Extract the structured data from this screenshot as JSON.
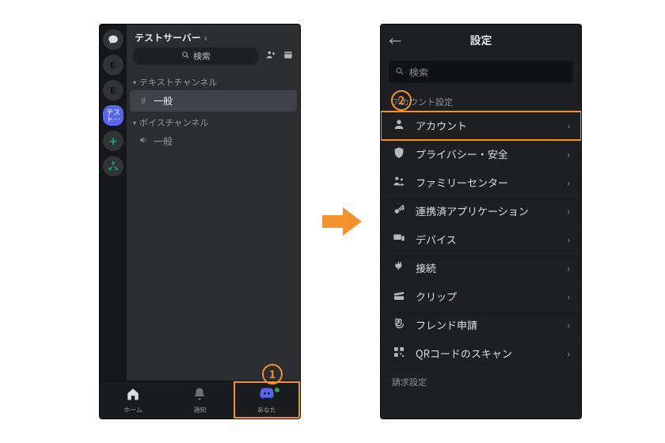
{
  "left": {
    "serverRail": {
      "activeLabel": "テスト…"
    },
    "serverName": "テストサーバー",
    "searchLabel": "検索",
    "categories": {
      "text": "テキストチャンネル",
      "voice": "ボイスチャンネル"
    },
    "channels": {
      "textGeneral": "一般",
      "voiceGeneral": "一般"
    },
    "tabs": {
      "home": "ホーム",
      "notify": "通知",
      "you": "あなた"
    }
  },
  "right": {
    "title": "設定",
    "searchPlaceholder": "検索",
    "groups": {
      "account": "アカウント設定",
      "billing": "請求設定"
    },
    "rows": {
      "account": "アカウント",
      "privacy": "プライバシー・安全",
      "family": "ファミリーセンター",
      "apps": "連携済アプリケーション",
      "devices": "デバイス",
      "connections": "接続",
      "clips": "クリップ",
      "friendreq": "フレンド申請",
      "qr": "QRコードのスキャン"
    }
  },
  "annotations": {
    "step1": "1",
    "step2": "2"
  }
}
